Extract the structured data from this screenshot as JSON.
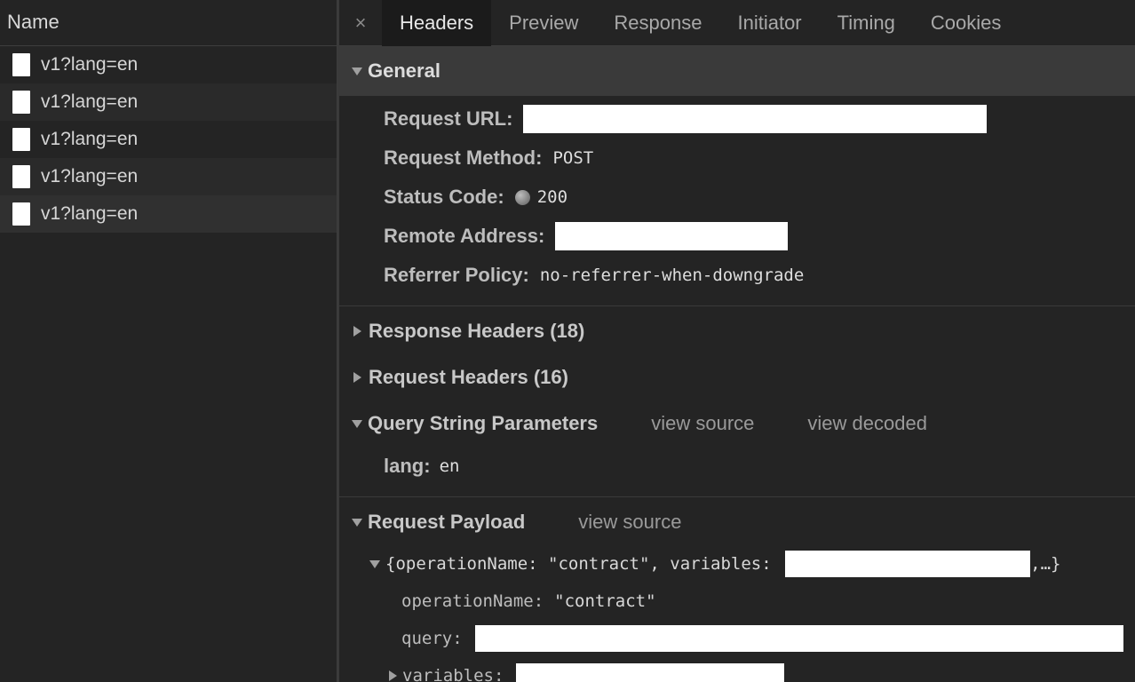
{
  "left": {
    "header": "Name",
    "requests": [
      "v1?lang=en",
      "v1?lang=en",
      "v1?lang=en",
      "v1?lang=en",
      "v1?lang=en"
    ]
  },
  "tabs": {
    "close": "×",
    "items": [
      "Headers",
      "Preview",
      "Response",
      "Initiator",
      "Timing",
      "Cookies"
    ]
  },
  "general": {
    "title": "General",
    "request_url_label": "Request URL:",
    "request_method_label": "Request Method:",
    "request_method": "POST",
    "status_code_label": "Status Code:",
    "status_code": "200",
    "remote_address_label": "Remote Address:",
    "referrer_policy_label": "Referrer Policy:",
    "referrer_policy": "no-referrer-when-downgrade"
  },
  "response_headers": {
    "title": "Response Headers (18)"
  },
  "request_headers": {
    "title": "Request Headers (16)"
  },
  "query": {
    "title": "Query String Parameters",
    "view_source": "view source",
    "view_decoded": "view decoded",
    "param_key": "lang:",
    "param_value": "en"
  },
  "payload": {
    "title": "Request Payload",
    "view_source": "view source",
    "summary_prefix": "{operationName: \"contract\", variables: ",
    "summary_suffix": ",…}",
    "operation_key": "operationName:",
    "operation_value": "\"contract\"",
    "query_key": "query:",
    "variables_key": "variables:"
  }
}
